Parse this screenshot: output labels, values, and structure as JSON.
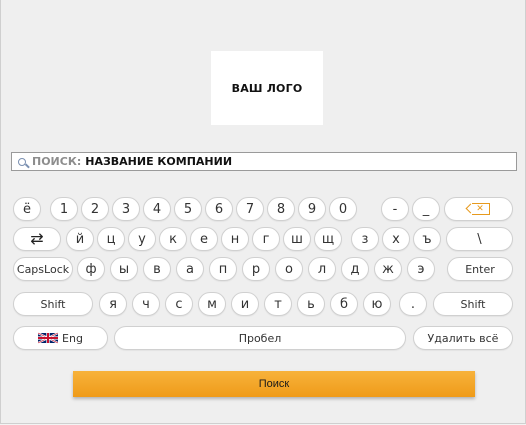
{
  "logo": {
    "text": "ВАШ ЛОГО"
  },
  "search": {
    "prefix": "ПОИСК:",
    "value": "НАЗВАНИЕ КОМПАНИИ"
  },
  "keyboard": {
    "row1": [
      "ё",
      "1",
      "2",
      "3",
      "4",
      "5",
      "6",
      "7",
      "8",
      "9",
      "0",
      "-",
      "_"
    ],
    "row2": [
      "й",
      "ц",
      "у",
      "к",
      "е",
      "н",
      "г",
      "ш",
      "щ",
      "з",
      "х",
      "ъ",
      "\\"
    ],
    "row3_left": "CapsLock",
    "row3": [
      "ф",
      "ы",
      "в",
      "а",
      "п",
      "р",
      "о",
      "л",
      "д",
      "ж",
      "э"
    ],
    "row3_right": "Enter",
    "row4_left": "Shift",
    "row4": [
      "я",
      "ч",
      "с",
      "м",
      "и",
      "т",
      "ь",
      "б",
      "ю",
      "."
    ],
    "row4_right": "Shift",
    "lang": "Eng",
    "space": "Пробел",
    "clear": "Удалить всё"
  },
  "button": {
    "search": "Поиск"
  },
  "colors": {
    "accent": "#ef9b19"
  }
}
